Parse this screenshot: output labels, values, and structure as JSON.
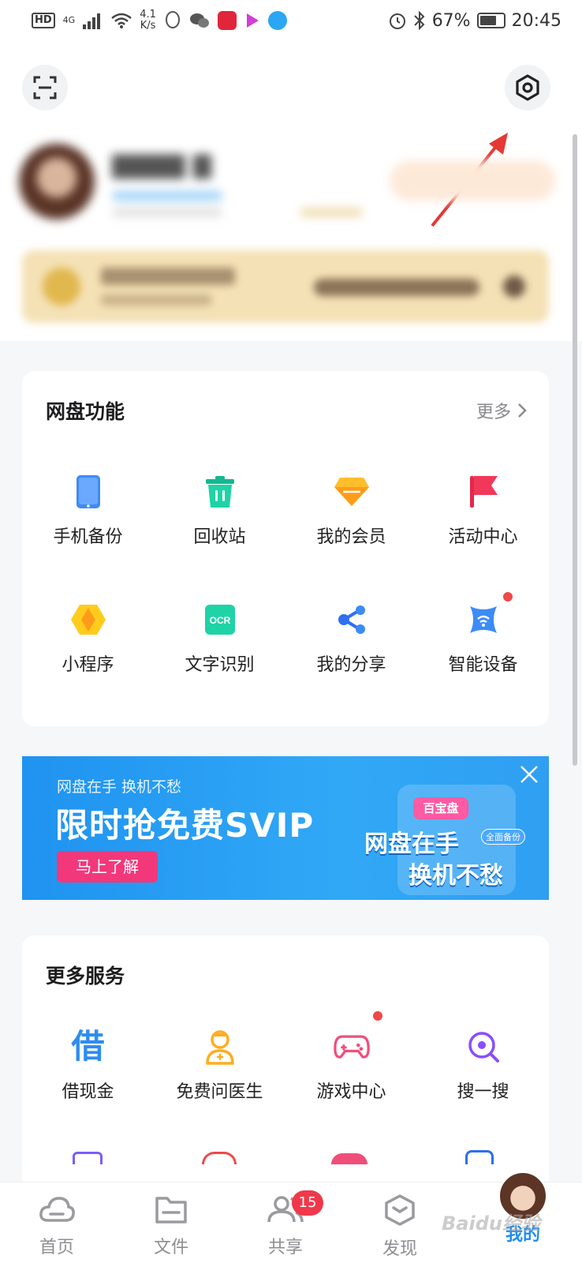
{
  "status_bar": {
    "hd": "HD",
    "network": "4G",
    "speed_value": "4.1",
    "speed_unit": "K/s",
    "battery": "67%",
    "time": "20:45"
  },
  "header": {
    "scan_icon": "scan-icon",
    "settings_icon": "settings-hexagon-icon"
  },
  "features": {
    "title": "网盘功能",
    "more": "更多",
    "items": [
      {
        "label": "手机备份",
        "icon": "phone-backup-icon",
        "color": "#3d8bf5"
      },
      {
        "label": "回收站",
        "icon": "trash-icon",
        "color": "#1fc9a4"
      },
      {
        "label": "我的会员",
        "icon": "diamond-icon",
        "color": "#ffb21c"
      },
      {
        "label": "活动中心",
        "icon": "flag-icon",
        "color": "#f2385a"
      },
      {
        "label": "小程序",
        "icon": "hexagon-icon",
        "color": "#ffcc1c"
      },
      {
        "label": "文字识别",
        "icon": "ocr-icon",
        "color": "#1fd3a6",
        "icon_text": "OCR"
      },
      {
        "label": "我的分享",
        "icon": "share-icon",
        "color": "#2f6ff0"
      },
      {
        "label": "智能设备",
        "icon": "smart-device-icon",
        "color": "#3d8bf5"
      }
    ]
  },
  "banner": {
    "subtitle": "网盘在手 换机不愁",
    "title": "限时抢免费SVIP",
    "cta": "马上了解",
    "art_logo": "百宝盘",
    "art_line1": "网盘在手",
    "art_line2": "换机不愁",
    "art_pill": "全面备份"
  },
  "services": {
    "title": "更多服务",
    "items": [
      {
        "label": "借现金",
        "icon": "loan-icon",
        "icon_text": "借",
        "color": "#2c8df0"
      },
      {
        "label": "免费问医生",
        "icon": "doctor-icon",
        "color": "#ffad1f"
      },
      {
        "label": "游戏中心",
        "icon": "gamepad-icon",
        "color": "#f04e7a"
      },
      {
        "label": "搜一搜",
        "icon": "search-icon",
        "color": "#8a4dff"
      }
    ]
  },
  "bottom_nav": {
    "tabs": [
      {
        "label": "首页",
        "icon": "cloud-icon"
      },
      {
        "label": "文件",
        "icon": "folder-icon"
      },
      {
        "label": "共享",
        "icon": "people-icon",
        "badge": "15"
      },
      {
        "label": "发现",
        "icon": "cube-icon"
      },
      {
        "label": "我的",
        "icon": "avatar-icon"
      }
    ]
  },
  "watermark": "Baidu经验",
  "colors": {
    "accent": "#1f8df0",
    "badge_red": "#f0384b",
    "banner_blue": "#2a9df4",
    "cta_pink": "#f2387a"
  }
}
